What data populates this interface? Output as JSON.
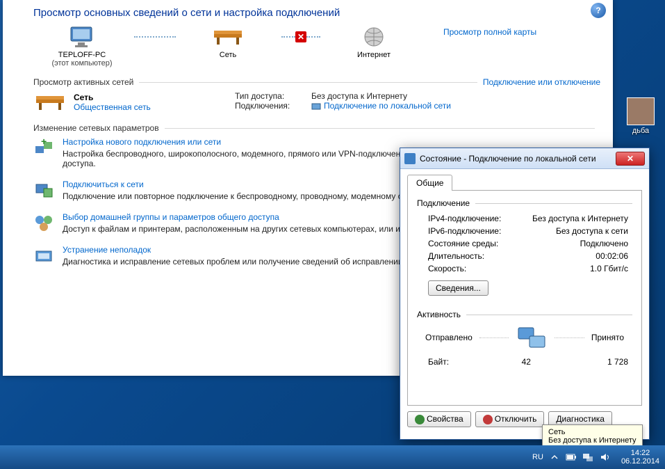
{
  "main": {
    "title": "Просмотр основных сведений о сети и настройка подключений",
    "map": {
      "node1": {
        "label": "TEPLOFF-PC",
        "sub": "(этот компьютер)"
      },
      "node2": {
        "label": "Сеть"
      },
      "node3": {
        "label": "Интернет"
      },
      "full_map_link": "Просмотр полной карты"
    },
    "active_networks": {
      "title": "Просмотр активных сетей",
      "action": "Подключение или отключение",
      "network": {
        "name": "Сеть",
        "type": "Общественная сеть",
        "access_label": "Тип доступа:",
        "access_value": "Без доступа к Интернету",
        "conn_label": "Подключения:",
        "conn_value": "Подключение по локальной сети"
      }
    },
    "settings": {
      "title": "Изменение сетевых параметров",
      "items": [
        {
          "title": "Настройка нового подключения или сети",
          "desc": "Настройка беспроводного, широкополосного, модемного, прямого или VPN-подключения или же настройка маршрутизатора или точки доступа."
        },
        {
          "title": "Подключиться к сети",
          "desc": "Подключение или повторное подключение к беспроводному, проводному, модемному сетевому соединению или подключение к VPN."
        },
        {
          "title": "Выбор домашней группы и параметров общего доступа",
          "desc": "Доступ к файлам и принтерам, расположенным на других сетевых компьютерах, или изменение параметров общего доступа."
        },
        {
          "title": "Устранение неполадок",
          "desc": "Диагностика и исправление сетевых проблем или получение сведений об исправлении."
        }
      ]
    }
  },
  "dialog": {
    "title": "Состояние - Подключение по локальной сети",
    "tab": "Общие",
    "connection": {
      "group": "Подключение",
      "ipv4_label": "IPv4-подключение:",
      "ipv4_value": "Без доступа к Интернету",
      "ipv6_label": "IPv6-подключение:",
      "ipv6_value": "Без доступа к сети",
      "media_label": "Состояние среды:",
      "media_value": "Подключено",
      "duration_label": "Длительность:",
      "duration_value": "00:02:06",
      "speed_label": "Скорость:",
      "speed_value": "1.0 Гбит/с",
      "details_btn": "Сведения..."
    },
    "activity": {
      "group": "Активность",
      "sent_label": "Отправлено",
      "recv_label": "Принято",
      "bytes_label": "Байт:",
      "sent": "42",
      "recv": "1 728"
    },
    "buttons": {
      "props": "Свойства",
      "disable": "Отключить",
      "diag": "Диагностика"
    }
  },
  "tooltip": {
    "line1": "Сеть",
    "line2": "Без доступа к Интернету"
  },
  "desktop": {
    "icon_label": "дьба"
  },
  "taskbar": {
    "lang": "RU",
    "time": "14:22",
    "date": "06.12.2014"
  }
}
